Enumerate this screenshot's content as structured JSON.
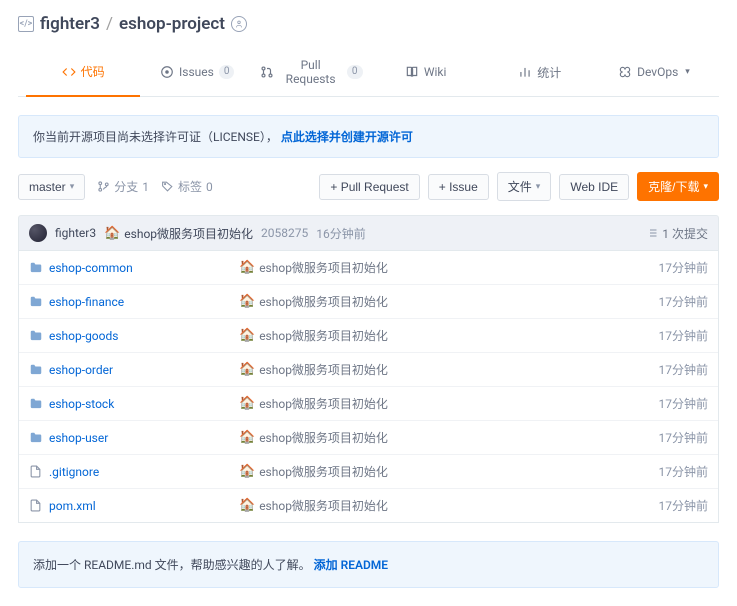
{
  "header": {
    "owner": "fighter3",
    "sep": "/",
    "repo": "eshop-project"
  },
  "tabs": {
    "code": "代码",
    "issues": "Issues",
    "issues_count": "0",
    "pr": "Pull Requests",
    "pr_count": "0",
    "wiki": "Wiki",
    "stats": "统计",
    "devops": "DevOps"
  },
  "notice": {
    "text": "你当前开源项目尚未选择许可证（LICENSE），",
    "link": "点此选择并创建开源许可"
  },
  "toolbar": {
    "branch": "master",
    "branches_ico_label": "分支",
    "branches_count": "1",
    "tags_label": "标签",
    "tags_count": "0",
    "pull_request": "+ Pull Request",
    "issue": "+ Issue",
    "files": "文件",
    "web_ide": "Web IDE",
    "clone": "克隆/下载"
  },
  "commit": {
    "author": "fighter3",
    "message": "eshop微服务项目初始化",
    "sha": "2058275",
    "time": "16分钟前",
    "count": "1 次提交"
  },
  "files": [
    {
      "type": "folder",
      "name": "eshop-common",
      "msg": "eshop微服务项目初始化",
      "time": "17分钟前"
    },
    {
      "type": "folder",
      "name": "eshop-finance",
      "msg": "eshop微服务项目初始化",
      "time": "17分钟前"
    },
    {
      "type": "folder",
      "name": "eshop-goods",
      "msg": "eshop微服务项目初始化",
      "time": "17分钟前"
    },
    {
      "type": "folder",
      "name": "eshop-order",
      "msg": "eshop微服务项目初始化",
      "time": "17分钟前"
    },
    {
      "type": "folder",
      "name": "eshop-stock",
      "msg": "eshop微服务项目初始化",
      "time": "17分钟前"
    },
    {
      "type": "folder",
      "name": "eshop-user",
      "msg": "eshop微服务项目初始化",
      "time": "17分钟前"
    },
    {
      "type": "file",
      "name": ".gitignore",
      "msg": "eshop微服务项目初始化",
      "time": "17分钟前"
    },
    {
      "type": "file",
      "name": "pom.xml",
      "msg": "eshop微服务项目初始化",
      "time": "17分钟前"
    }
  ],
  "readme": {
    "text": "添加一个 README.md 文件，帮助感兴趣的人了解。",
    "link": "添加 README"
  }
}
